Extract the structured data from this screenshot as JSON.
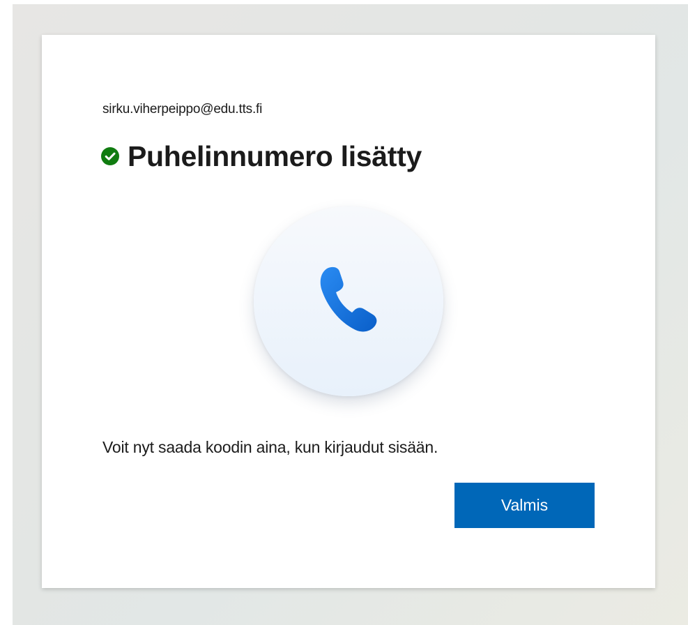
{
  "account": {
    "email": "sirku.viherpeippo@edu.tts.fi"
  },
  "status": {
    "icon": "check-circle-icon",
    "title": "Puhelinnumero lisätty"
  },
  "illustration": {
    "icon": "phone-icon"
  },
  "message": "Voit nyt saada koodin aina, kun kirjaudut sisään.",
  "actions": {
    "done_label": "Valmis"
  },
  "colors": {
    "accent": "#0067b8",
    "success": "#107c10",
    "phone_blue": "#1a73e8"
  }
}
